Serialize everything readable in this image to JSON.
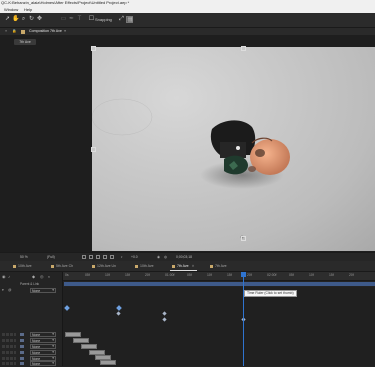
{
  "window": {
    "title": "QC-K:Behanzin_alaia\\Holmes\\After Effects\\Project\\Untitled Project.aep *"
  },
  "menu": [
    "Window",
    "Help"
  ],
  "toolbar": {
    "snapping_label": "Snapping"
  },
  "composition": {
    "tab_label": "Composition 7th Ave",
    "breadcrumb": "7th Ave"
  },
  "viewer_bar": {
    "zoom": "50 %",
    "resolution": "(Full)",
    "timecode": "0;00;03;18",
    "exposure": "+0.0"
  },
  "timeline_tabs": [
    {
      "label": "10th Ave",
      "active": false
    },
    {
      "label": "5th Ave Ch",
      "active": false
    },
    {
      "label": "12th Ave Un",
      "active": false
    },
    {
      "label": "10th Ave",
      "active": false
    },
    {
      "label": "7th Ave",
      "active": true
    },
    {
      "label": "7th Ave",
      "active": false
    }
  ],
  "layers_panel": {
    "source_label": "Parent & Link",
    "top_dropdown": "None",
    "rows": [
      "None",
      "None",
      "None",
      "None",
      "None",
      "None"
    ]
  },
  "ruler_ticks": [
    "0s",
    "05f",
    "10f",
    "15f",
    "20f",
    "01:00f",
    "05f",
    "10f",
    "15f",
    "20f",
    "02:00f",
    "05f",
    "10f",
    "15f",
    "20f"
  ],
  "tooltip": "Time Ruler (Click to set thumb)",
  "colors": {
    "playhead": "#2f74d0",
    "work_area": "#3e5a8a",
    "label_yellow": "#c9a96b"
  }
}
